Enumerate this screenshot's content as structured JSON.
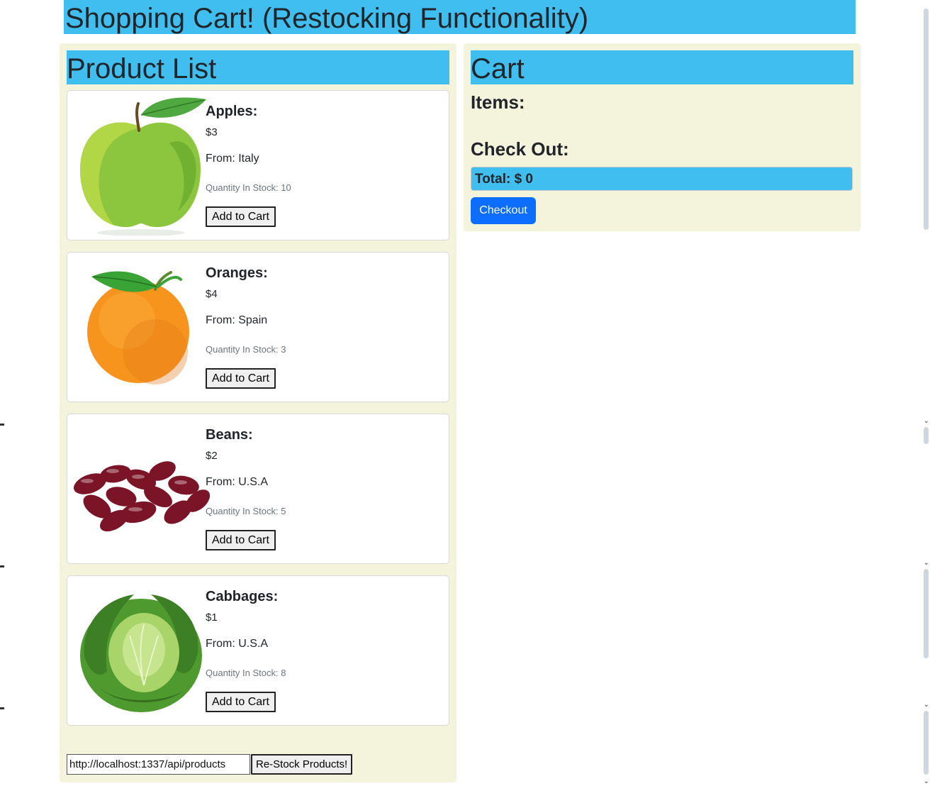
{
  "page": {
    "title": "Shopping Cart! (Restocking Functionality)"
  },
  "product_list": {
    "heading": "Product List",
    "add_label": "Add to Cart",
    "products": [
      {
        "name": "Apples:",
        "price": "$3",
        "origin": "From: Italy",
        "stock": "Quantity In Stock: 10",
        "icon": "apple-icon"
      },
      {
        "name": "Oranges:",
        "price": "$4",
        "origin": "From: Spain",
        "stock": "Quantity In Stock: 3",
        "icon": "orange-icon"
      },
      {
        "name": "Beans:",
        "price": "$2",
        "origin": "From: U.S.A",
        "stock": "Quantity In Stock: 5",
        "icon": "beans-icon"
      },
      {
        "name": "Cabbages:",
        "price": "$1",
        "origin": "From: U.S.A",
        "stock": "Quantity In Stock: 8",
        "icon": "cabbage-icon"
      }
    ]
  },
  "restock": {
    "url_value": "http://localhost:1337/api/products",
    "button_label": "Re-Stock Products!"
  },
  "cart": {
    "heading": "Cart",
    "items_label": "Items:",
    "checkout_heading": "Check Out:",
    "total_label": "Total: $ 0",
    "checkout_button": "Checkout"
  },
  "colors": {
    "header_blue": "#3fbeef",
    "panel_bg": "#f4f3dc",
    "checkout_blue": "#0d6efd"
  }
}
